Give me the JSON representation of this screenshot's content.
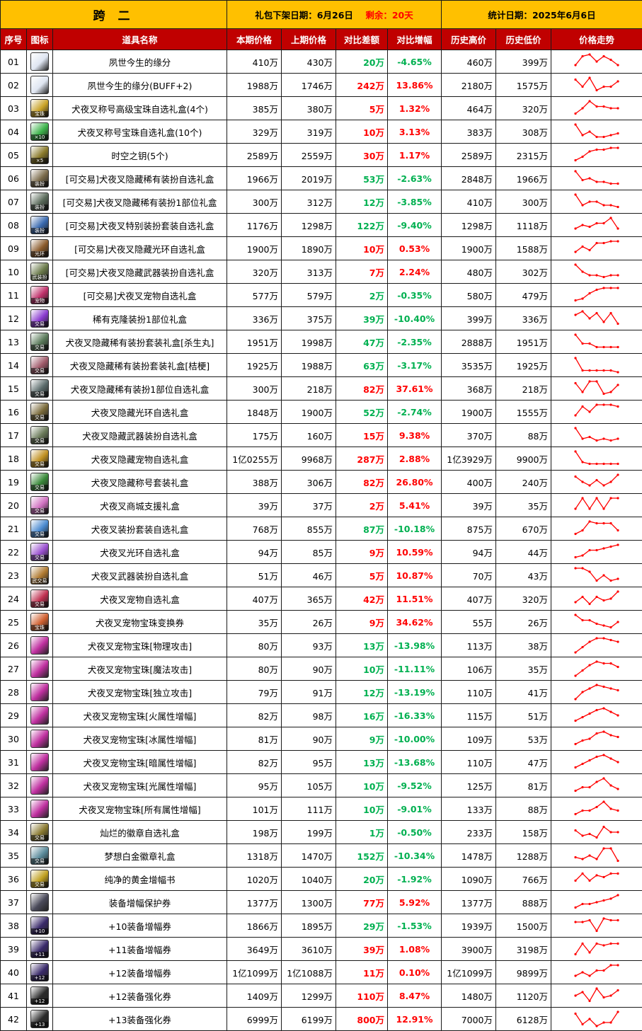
{
  "header": {
    "server": "跨 二",
    "offline_label": "礼包下架日期：",
    "offline_date": "6月26日",
    "remain_label": "剩余：",
    "remain_value": "20天",
    "stat_label": "统计日期：",
    "stat_date": "2025年6月6日"
  },
  "columns": [
    "序号",
    "图标",
    "道具名称",
    "本期价格",
    "上期价格",
    "对比差额",
    "对比增幅",
    "历史高价",
    "历史低价",
    "价格走势"
  ],
  "colors": {
    "up": "#ff0000",
    "down": "#00b050",
    "header_bg": "#c00000",
    "top_bg": "#ffc000",
    "alt_row": "#fce4d6"
  },
  "rows": [
    {
      "no": "01",
      "icon": "white-gift-icon",
      "icon_color": "#dfe6f2",
      "name": "夙世今生的缘分",
      "cur": "410万",
      "prev": "430万",
      "diff": "20万",
      "pct": "-4.65%",
      "high": "460万",
      "low": "399万",
      "trend": [
        3,
        8,
        9,
        5,
        8,
        6,
        3
      ]
    },
    {
      "no": "02",
      "icon": "white-gift-icon",
      "icon_color": "#dfe6f2",
      "name": "夙世今生的缘分(BUFF+2)",
      "cur": "1988万",
      "prev": "1746万",
      "diff": "242万",
      "pct": "13.86%",
      "high": "2180万",
      "low": "1575万",
      "trend": [
        8,
        4,
        9,
        2,
        4,
        4,
        7
      ]
    },
    {
      "no": "03",
      "icon": "gold-orb-icon",
      "icon_color": "#c9a227",
      "icon_tag": "宝珠",
      "name": "犬夜叉称号高级宝珠自选礼盒(4个)",
      "cur": "385万",
      "prev": "380万",
      "diff": "5万",
      "pct": "1.32%",
      "high": "464万",
      "low": "320万",
      "trend": [
        2,
        5,
        9,
        6,
        6,
        5,
        5
      ]
    },
    {
      "no": "04",
      "icon": "green-orb-icon",
      "icon_color": "#3cb34a",
      "icon_tag": "×10",
      "name": "犬夜叉称号宝珠自选礼盒(10个)",
      "cur": "329万",
      "prev": "319万",
      "diff": "10万",
      "pct": "3.13%",
      "high": "383万",
      "low": "308万",
      "trend": [
        9,
        3,
        5,
        2,
        2,
        3,
        4
      ]
    },
    {
      "no": "05",
      "icon": "key-icon",
      "icon_color": "#8a7a2a",
      "icon_tag": "×5",
      "name": "时空之钥(5个)",
      "cur": "2589万",
      "prev": "2559万",
      "diff": "30万",
      "pct": "1.17%",
      "high": "2589万",
      "low": "2315万",
      "trend": [
        2,
        4,
        7,
        8,
        8,
        9,
        9
      ]
    },
    {
      "no": "06",
      "icon": "avatar-box-icon",
      "icon_color": "#7a6a4a",
      "icon_tag": "装扮",
      "name": "[可交易]犬夜叉隐藏稀有装扮自选礼盒",
      "cur": "1966万",
      "prev": "2019万",
      "diff": "53万",
      "pct": "-2.63%",
      "high": "2848万",
      "low": "1966万",
      "trend": [
        9,
        4,
        5,
        3,
        3,
        2,
        2
      ]
    },
    {
      "no": "07",
      "icon": "avatar-box-icon",
      "icon_color": "#5a6a5a",
      "icon_tag": "装扮",
      "name": "[可交易]犬夜叉隐藏稀有装扮1部位礼盒",
      "cur": "300万",
      "prev": "312万",
      "diff": "12万",
      "pct": "-3.85%",
      "high": "410万",
      "low": "300万",
      "trend": [
        9,
        3,
        5,
        5,
        3,
        3,
        2
      ]
    },
    {
      "no": "08",
      "icon": "blue-chest-icon",
      "icon_color": "#3a6ab0",
      "icon_tag": "装扮",
      "name": "[可交易]犬夜叉特别装扮套装自选礼盒",
      "cur": "1176万",
      "prev": "1298万",
      "diff": "122万",
      "pct": "-9.40%",
      "high": "1298万",
      "low": "1118万",
      "trend": [
        3,
        5,
        4,
        6,
        6,
        9,
        3
      ]
    },
    {
      "no": "09",
      "icon": "aura-chest-icon",
      "icon_color": "#8a5a2a",
      "icon_tag": "光环",
      "name": "[可交易]犬夜叉隐藏光环自选礼盒",
      "cur": "1900万",
      "prev": "1890万",
      "diff": "10万",
      "pct": "0.53%",
      "high": "1900万",
      "low": "1588万",
      "trend": [
        3,
        6,
        4,
        8,
        8,
        9,
        9
      ]
    },
    {
      "no": "10",
      "icon": "weapon-chest-icon",
      "icon_color": "#6a7a4a",
      "icon_tag": "武装扮",
      "name": "[可交易]犬夜叉隐藏武器装扮自选礼盒",
      "cur": "320万",
      "prev": "313万",
      "diff": "7万",
      "pct": "2.24%",
      "high": "480万",
      "low": "302万",
      "trend": [
        9,
        5,
        3,
        3,
        2,
        3,
        3
      ]
    },
    {
      "no": "11",
      "icon": "pet-gift-icon",
      "icon_color": "#c0306a",
      "icon_tag": "宠物",
      "name": "[可交易]犬夜叉宠物自选礼盒",
      "cur": "577万",
      "prev": "579万",
      "diff": "2万",
      "pct": "-0.35%",
      "high": "580万",
      "low": "479万",
      "trend": [
        2,
        3,
        6,
        8,
        9,
        9,
        9
      ]
    },
    {
      "no": "12",
      "icon": "purple-orb-icon",
      "icon_color": "#8a3ad0",
      "icon_tag": "交易",
      "name": "稀有克隆装扮1部位礼盒",
      "cur": "336万",
      "prev": "375万",
      "diff": "39万",
      "pct": "-10.40%",
      "high": "399万",
      "low": "336万",
      "trend": [
        7,
        9,
        5,
        8,
        3,
        8,
        2
      ]
    },
    {
      "no": "13",
      "icon": "avatar-box-icon",
      "icon_color": "#5a7a5a",
      "icon_tag": "交易",
      "name": "犬夜叉隐藏稀有装扮套装礼盒[杀生丸]",
      "cur": "1951万",
      "prev": "1998万",
      "diff": "47万",
      "pct": "-2.35%",
      "high": "2888万",
      "low": "1951万",
      "trend": [
        9,
        4,
        4,
        2,
        2,
        2,
        2
      ]
    },
    {
      "no": "14",
      "icon": "avatar-box-icon",
      "icon_color": "#a05a6a",
      "icon_tag": "交易",
      "name": "犬夜叉隐藏稀有装扮套装礼盒[桔梗]",
      "cur": "1925万",
      "prev": "1988万",
      "diff": "63万",
      "pct": "-3.17%",
      "high": "3535万",
      "low": "1925万",
      "trend": [
        9,
        2,
        2,
        2,
        2,
        2,
        1
      ]
    },
    {
      "no": "15",
      "icon": "avatar-box-icon",
      "icon_color": "#5a6a6a",
      "icon_tag": "交易",
      "name": "犬夜叉隐藏稀有装扮1部位自选礼盒",
      "cur": "300万",
      "prev": "218万",
      "diff": "82万",
      "pct": "37.61%",
      "high": "368万",
      "low": "218万",
      "trend": [
        8,
        3,
        9,
        9,
        2,
        3,
        7
      ]
    },
    {
      "no": "16",
      "icon": "aura-chest-icon",
      "icon_color": "#7a6a3a",
      "icon_tag": "交易",
      "name": "犬夜叉隐藏光环自选礼盒",
      "cur": "1848万",
      "prev": "1900万",
      "diff": "52万",
      "pct": "-2.74%",
      "high": "1900万",
      "low": "1555万",
      "trend": [
        3,
        8,
        5,
        9,
        9,
        9,
        8
      ]
    },
    {
      "no": "17",
      "icon": "weapon-chest-icon",
      "icon_color": "#6a7a5a",
      "icon_tag": "交易",
      "name": "犬夜叉隐藏武器装扮自选礼盒",
      "cur": "175万",
      "prev": "160万",
      "diff": "15万",
      "pct": "9.38%",
      "high": "370万",
      "low": "88万",
      "trend": [
        9,
        3,
        4,
        2,
        3,
        2,
        3
      ]
    },
    {
      "no": "18",
      "icon": "gold-chest-icon",
      "icon_color": "#c09020",
      "icon_tag": "交易",
      "name": "犬夜叉隐藏宠物自选礼盒",
      "cur": "1亿0255万",
      "prev": "9968万",
      "diff": "287万",
      "pct": "2.88%",
      "high": "1亿3929万",
      "low": "9900万",
      "trend": [
        9,
        3,
        2,
        2,
        2,
        2,
        2
      ]
    },
    {
      "no": "19",
      "icon": "green-chest-icon",
      "icon_color": "#3a8a3a",
      "icon_tag": "交易",
      "name": "犬夜叉隐藏称号套装礼盒",
      "cur": "388万",
      "prev": "306万",
      "diff": "82万",
      "pct": "26.80%",
      "high": "400万",
      "low": "240万",
      "trend": [
        8,
        5,
        3,
        6,
        3,
        5,
        9
      ]
    },
    {
      "no": "20",
      "icon": "pink-box-icon",
      "icon_color": "#d070c0",
      "icon_tag": "交易",
      "name": "犬夜叉商城支援礼盒",
      "cur": "39万",
      "prev": "37万",
      "diff": "2万",
      "pct": "5.41%",
      "high": "39万",
      "low": "35万",
      "trend": [
        3,
        9,
        3,
        9,
        3,
        9,
        9
      ]
    },
    {
      "no": "21",
      "icon": "blue-box-icon",
      "icon_color": "#4a8ad0",
      "icon_tag": "交易",
      "name": "犬夜叉装扮套装自选礼盒",
      "cur": "768万",
      "prev": "855万",
      "diff": "87万",
      "pct": "-10.18%",
      "high": "875万",
      "low": "670万",
      "trend": [
        2,
        4,
        9,
        8,
        8,
        8,
        4
      ]
    },
    {
      "no": "22",
      "icon": "violet-box-icon",
      "icon_color": "#9a50d0",
      "icon_tag": "交易",
      "name": "犬夜叉光环自选礼盒",
      "cur": "94万",
      "prev": "85万",
      "diff": "9万",
      "pct": "10.59%",
      "high": "94万",
      "low": "44万",
      "trend": [
        2,
        3,
        6,
        6,
        7,
        8,
        9
      ]
    },
    {
      "no": "23",
      "icon": "weapon-box-icon",
      "icon_color": "#b07a30",
      "icon_tag": "武交易",
      "name": "犬夜叉武器装扮自选礼盒",
      "cur": "51万",
      "prev": "46万",
      "diff": "5万",
      "pct": "10.87%",
      "high": "70万",
      "low": "43万",
      "trend": [
        9,
        9,
        7,
        2,
        5,
        2,
        3
      ]
    },
    {
      "no": "24",
      "icon": "red-box-icon",
      "icon_color": "#c03050",
      "icon_tag": "交易",
      "name": "犬夜叉宠物自选礼盒",
      "cur": "407万",
      "prev": "365万",
      "diff": "42万",
      "pct": "11.51%",
      "high": "407万",
      "low": "320万",
      "trend": [
        3,
        6,
        2,
        6,
        4,
        5,
        9
      ]
    },
    {
      "no": "25",
      "icon": "pet-ticket-icon",
      "icon_color": "#d06030",
      "icon_tag": "宝珠",
      "name": "犬夜叉宠物宝珠变换券",
      "cur": "35万",
      "prev": "26万",
      "diff": "9万",
      "pct": "34.62%",
      "high": "55万",
      "low": "26万",
      "trend": [
        9,
        6,
        6,
        4,
        3,
        2,
        5
      ]
    },
    {
      "no": "26",
      "icon": "pet-orb-icon",
      "icon_color": "#c030a0",
      "name": "犬夜叉宠物宝珠[物理攻击]",
      "cur": "80万",
      "prev": "93万",
      "diff": "13万",
      "pct": "-13.98%",
      "high": "113万",
      "low": "38万",
      "trend": [
        1,
        4,
        7,
        9,
        9,
        8,
        7
      ]
    },
    {
      "no": "27",
      "icon": "pet-orb-icon",
      "icon_color": "#c030a0",
      "name": "犬夜叉宠物宝珠[魔法攻击]",
      "cur": "80万",
      "prev": "90万",
      "diff": "10万",
      "pct": "-11.11%",
      "high": "106万",
      "low": "35万",
      "trend": [
        1,
        4,
        7,
        9,
        8,
        8,
        6
      ]
    },
    {
      "no": "28",
      "icon": "pet-orb-icon",
      "icon_color": "#c030a0",
      "name": "犬夜叉宠物宝珠[独立攻击]",
      "cur": "79万",
      "prev": "91万",
      "diff": "12万",
      "pct": "-13.19%",
      "high": "110万",
      "low": "41万",
      "trend": [
        1,
        5,
        7,
        9,
        8,
        7,
        6
      ]
    },
    {
      "no": "29",
      "icon": "pet-orb-icon",
      "icon_color": "#c030a0",
      "name": "犬夜叉宠物宝珠[火属性增幅]",
      "cur": "82万",
      "prev": "98万",
      "diff": "16万",
      "pct": "-16.33%",
      "high": "115万",
      "low": "51万",
      "trend": [
        2,
        4,
        6,
        8,
        9,
        7,
        5
      ]
    },
    {
      "no": "30",
      "icon": "pet-orb-icon",
      "icon_color": "#c030a0",
      "name": "犬夜叉宠物宝珠[冰属性增幅]",
      "cur": "81万",
      "prev": "90万",
      "diff": "9万",
      "pct": "-10.00%",
      "high": "109万",
      "low": "53万",
      "trend": [
        2,
        4,
        5,
        8,
        9,
        7,
        6
      ]
    },
    {
      "no": "31",
      "icon": "pet-orb-icon",
      "icon_color": "#c030a0",
      "name": "犬夜叉宠物宝珠[暗属性增幅]",
      "cur": "82万",
      "prev": "95万",
      "diff": "13万",
      "pct": "-13.68%",
      "high": "110万",
      "low": "47万",
      "trend": [
        2,
        4,
        6,
        8,
        9,
        7,
        5
      ]
    },
    {
      "no": "32",
      "icon": "pet-orb-icon",
      "icon_color": "#c030a0",
      "name": "犬夜叉宠物宝珠[光属性增幅]",
      "cur": "95万",
      "prev": "105万",
      "diff": "10万",
      "pct": "-9.52%",
      "high": "125万",
      "low": "81万",
      "trend": [
        2,
        4,
        4,
        7,
        9,
        5,
        3
      ]
    },
    {
      "no": "33",
      "icon": "pet-orb-icon",
      "icon_color": "#c030a0",
      "name": "犬夜叉宠物宝珠[所有属性增幅]",
      "cur": "101万",
      "prev": "111万",
      "diff": "10万",
      "pct": "-9.01%",
      "high": "133万",
      "low": "88万",
      "trend": [
        2,
        4,
        4,
        6,
        9,
        5,
        4
      ]
    },
    {
      "no": "34",
      "icon": "emblem-icon",
      "icon_color": "#8a7a30",
      "icon_tag": "交易",
      "name": "灿烂的徽章自选礼盒",
      "cur": "198万",
      "prev": "199万",
      "diff": "1万",
      "pct": "-0.50%",
      "high": "233万",
      "low": "158万",
      "trend": [
        6,
        3,
        4,
        2,
        8,
        5,
        5
      ]
    },
    {
      "no": "35",
      "icon": "platinum-emblem-icon",
      "icon_color": "#5a8a9a",
      "icon_tag": "交易",
      "name": "梦想白金徽章礼盒",
      "cur": "1318万",
      "prev": "1470万",
      "diff": "152万",
      "pct": "-10.34%",
      "high": "1478万",
      "low": "1288万",
      "trend": [
        4,
        3,
        5,
        3,
        9,
        9,
        2
      ]
    },
    {
      "no": "36",
      "icon": "gold-book-icon",
      "icon_color": "#c0a020",
      "icon_tag": "交易",
      "name": "纯净的黄金增幅书",
      "cur": "1020万",
      "prev": "1040万",
      "diff": "20万",
      "pct": "-1.92%",
      "high": "1090万",
      "low": "766万",
      "trend": [
        4,
        8,
        4,
        7,
        6,
        8,
        8
      ]
    },
    {
      "no": "37",
      "icon": "hammer-icon",
      "icon_color": "#4a4a5a",
      "name": "装备增幅保护券",
      "cur": "1377万",
      "prev": "1300万",
      "diff": "77万",
      "pct": "5.92%",
      "high": "1377万",
      "low": "888万",
      "trend": [
        2,
        4,
        4,
        5,
        6,
        7,
        9
      ]
    },
    {
      "no": "38",
      "icon": "amplify-10-icon",
      "icon_color": "#3a2a6a",
      "icon_tag": "+10",
      "name": "+10装备增幅券",
      "cur": "1866万",
      "prev": "1895万",
      "diff": "29万",
      "pct": "-1.53%",
      "high": "1939万",
      "low": "1500万",
      "trend": [
        7,
        7,
        8,
        2,
        9,
        8,
        8
      ]
    },
    {
      "no": "39",
      "icon": "amplify-11-icon",
      "icon_color": "#3a2a6a",
      "icon_tag": "+11",
      "name": "+11装备增幅券",
      "cur": "3649万",
      "prev": "3610万",
      "diff": "39万",
      "pct": "1.08%",
      "high": "3900万",
      "low": "3198万",
      "trend": [
        2,
        8,
        3,
        8,
        7,
        8,
        8
      ]
    },
    {
      "no": "40",
      "icon": "amplify-12-icon",
      "icon_color": "#3a2a6a",
      "icon_tag": "+12",
      "name": "+12装备增幅券",
      "cur": "1亿1099万",
      "prev": "1亿1088万",
      "diff": "11万",
      "pct": "0.10%",
      "high": "1亿1099万",
      "low": "9899万",
      "trend": [
        3,
        5,
        3,
        6,
        6,
        9,
        9
      ]
    },
    {
      "no": "41",
      "icon": "refine-12-icon",
      "icon_color": "#2a2a2a",
      "icon_tag": "+12",
      "name": "+12装备强化券",
      "cur": "1409万",
      "prev": "1299万",
      "diff": "110万",
      "pct": "8.47%",
      "high": "1480万",
      "low": "1120万",
      "trend": [
        5,
        7,
        2,
        9,
        4,
        5,
        8
      ]
    },
    {
      "no": "42",
      "icon": "refine-13-icon",
      "icon_color": "#2a2a2a",
      "icon_tag": "+13",
      "name": "+13装备强化券",
      "cur": "6999万",
      "prev": "6199万",
      "diff": "800万",
      "pct": "12.91%",
      "high": "7000万",
      "low": "6128万",
      "trend": [
        8,
        2,
        5,
        1,
        3,
        3,
        9
      ]
    }
  ]
}
